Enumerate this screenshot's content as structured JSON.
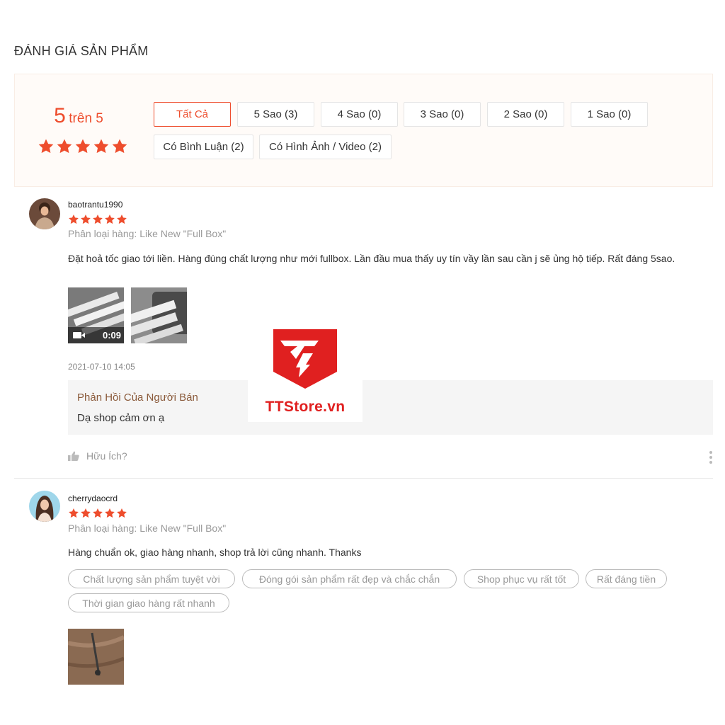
{
  "section_title": "ĐÁNH GIÁ SẢN PHẨM",
  "overview": {
    "score": "5",
    "score_suffix": "trên 5",
    "rating": 5,
    "filters": [
      "Tất Cả",
      "5 Sao (3)",
      "4 Sao (0)",
      "3 Sao (0)",
      "2 Sao (0)",
      "1 Sao (0)",
      "Có Bình Luận (2)",
      "Có Hình Ảnh / Video (2)"
    ],
    "active_filter": "Tất Cả"
  },
  "reviews": [
    {
      "username": "baotrantu1990",
      "rating": 5,
      "variant": "Phân loại hàng: Like New \"Full Box\"",
      "comment": "Đặt hoả tốc giao tới liền. Hàng đúng chất lượng như mới fullbox. Lần đầu mua thấy uy tín vầy lần sau cần j sẽ ủng hộ tiếp. Rất đáng 5sao.",
      "video_duration": "0:09",
      "timestamp": "2021-07-10 14:05",
      "seller_reply": {
        "title": "Phản Hồi Của Người Bán",
        "text": "Dạ shop cảm ơn ạ"
      },
      "helpful_label": "Hữu Ích?"
    },
    {
      "username": "cherrydaocrd",
      "rating": 5,
      "variant": "Phân loại hàng: Like New \"Full Box\"",
      "comment": "Hàng chuẩn ok, giao hàng nhanh, shop trả lời cũng nhanh. Thanks",
      "tags": [
        "Chất lượng sản phẩm tuyệt vời",
        "Đóng gói sản phẩm rất đẹp và chắc chắn",
        "Shop phục vụ rất tốt",
        "Rất đáng tiền",
        "Thời gian giao hàng rất nhanh"
      ]
    }
  ],
  "watermark": {
    "brand": "TTStore.vn"
  },
  "colors": {
    "accent": "#ee4d2d",
    "watermark_red": "#e02020"
  }
}
